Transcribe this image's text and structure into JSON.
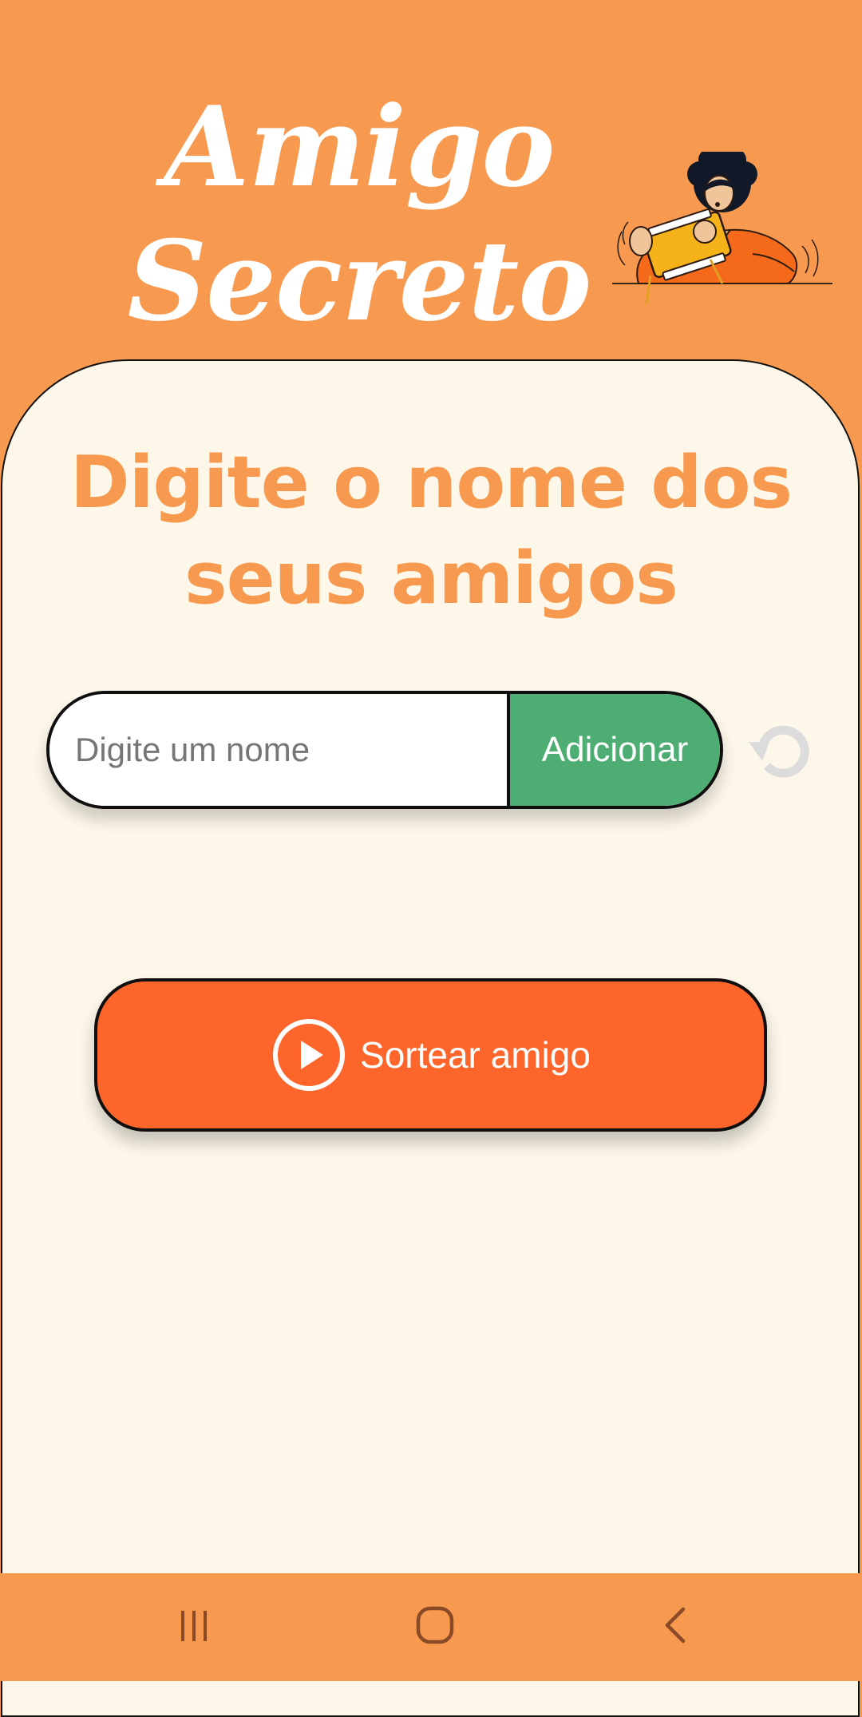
{
  "app": {
    "title_line1": "Amigo",
    "title_line2": "Secreto"
  },
  "main": {
    "heading_line1": "Digite o nome dos",
    "heading_line2": "seus amigos",
    "name_input": {
      "value": "",
      "placeholder": "Digite um nome"
    },
    "add_button_label": "Adicionar",
    "reset_icon": "refresh-icon",
    "draw_button_label": "Sortear amigo",
    "draw_icon": "play-circle-icon"
  },
  "nav_bar": {
    "items": [
      "recent-apps-icon",
      "home-icon",
      "back-icon"
    ]
  },
  "colors": {
    "background": "#F79A50",
    "card": "#FDF7EA",
    "heading": "#F79A50",
    "add_button": "#4DAD72",
    "draw_button": "#FE652B",
    "reset_icon": "#DCDCDC"
  }
}
